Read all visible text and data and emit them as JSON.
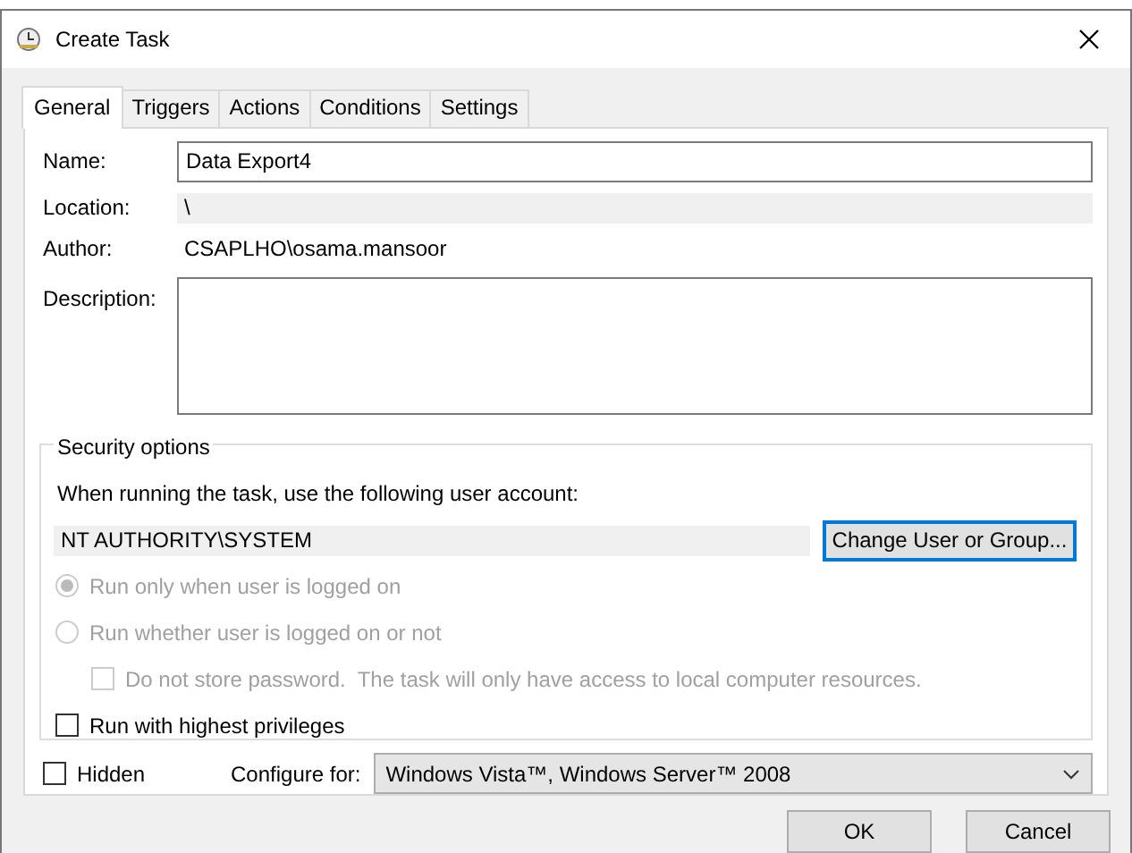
{
  "window": {
    "title": "Create Task"
  },
  "tabs": [
    {
      "label": "General",
      "selected": true
    },
    {
      "label": "Triggers",
      "selected": false
    },
    {
      "label": "Actions",
      "selected": false
    },
    {
      "label": "Conditions",
      "selected": false
    },
    {
      "label": "Settings",
      "selected": false
    }
  ],
  "general": {
    "name": {
      "label": "Name:",
      "value": "Data Export4"
    },
    "location": {
      "label": "Location:",
      "value": "\\"
    },
    "author": {
      "label": "Author:",
      "value": "CSAPLHO\\osama.mansoor"
    },
    "description": {
      "label": "Description:"
    }
  },
  "security": {
    "title": "Security options",
    "account_prompt": "When running the task, use the following user account:",
    "account": "NT AUTHORITY\\SYSTEM",
    "change_button": "Change User or Group...",
    "options": [
      {
        "kind": "radio",
        "label": "Run only when user is logged on",
        "selected": true,
        "disabled": true
      },
      {
        "kind": "radio",
        "label": "Run whether user is logged on or not",
        "selected": false,
        "disabled": true,
        "children": [
          {
            "kind": "checkbox",
            "label": "Do not store password.  The task will only have access to local computer resources.",
            "checked": false,
            "disabled": true
          }
        ]
      },
      {
        "kind": "checkbox",
        "label": "Run with highest privileges",
        "checked": false,
        "disabled": false
      }
    ]
  },
  "hidden": {
    "label": "Hidden",
    "checked": false
  },
  "configure": {
    "label": "Configure for:",
    "value": "Windows Vista™, Windows Server™ 2008"
  },
  "buttons": [
    {
      "label": "OK"
    },
    {
      "label": "Cancel"
    }
  ]
}
